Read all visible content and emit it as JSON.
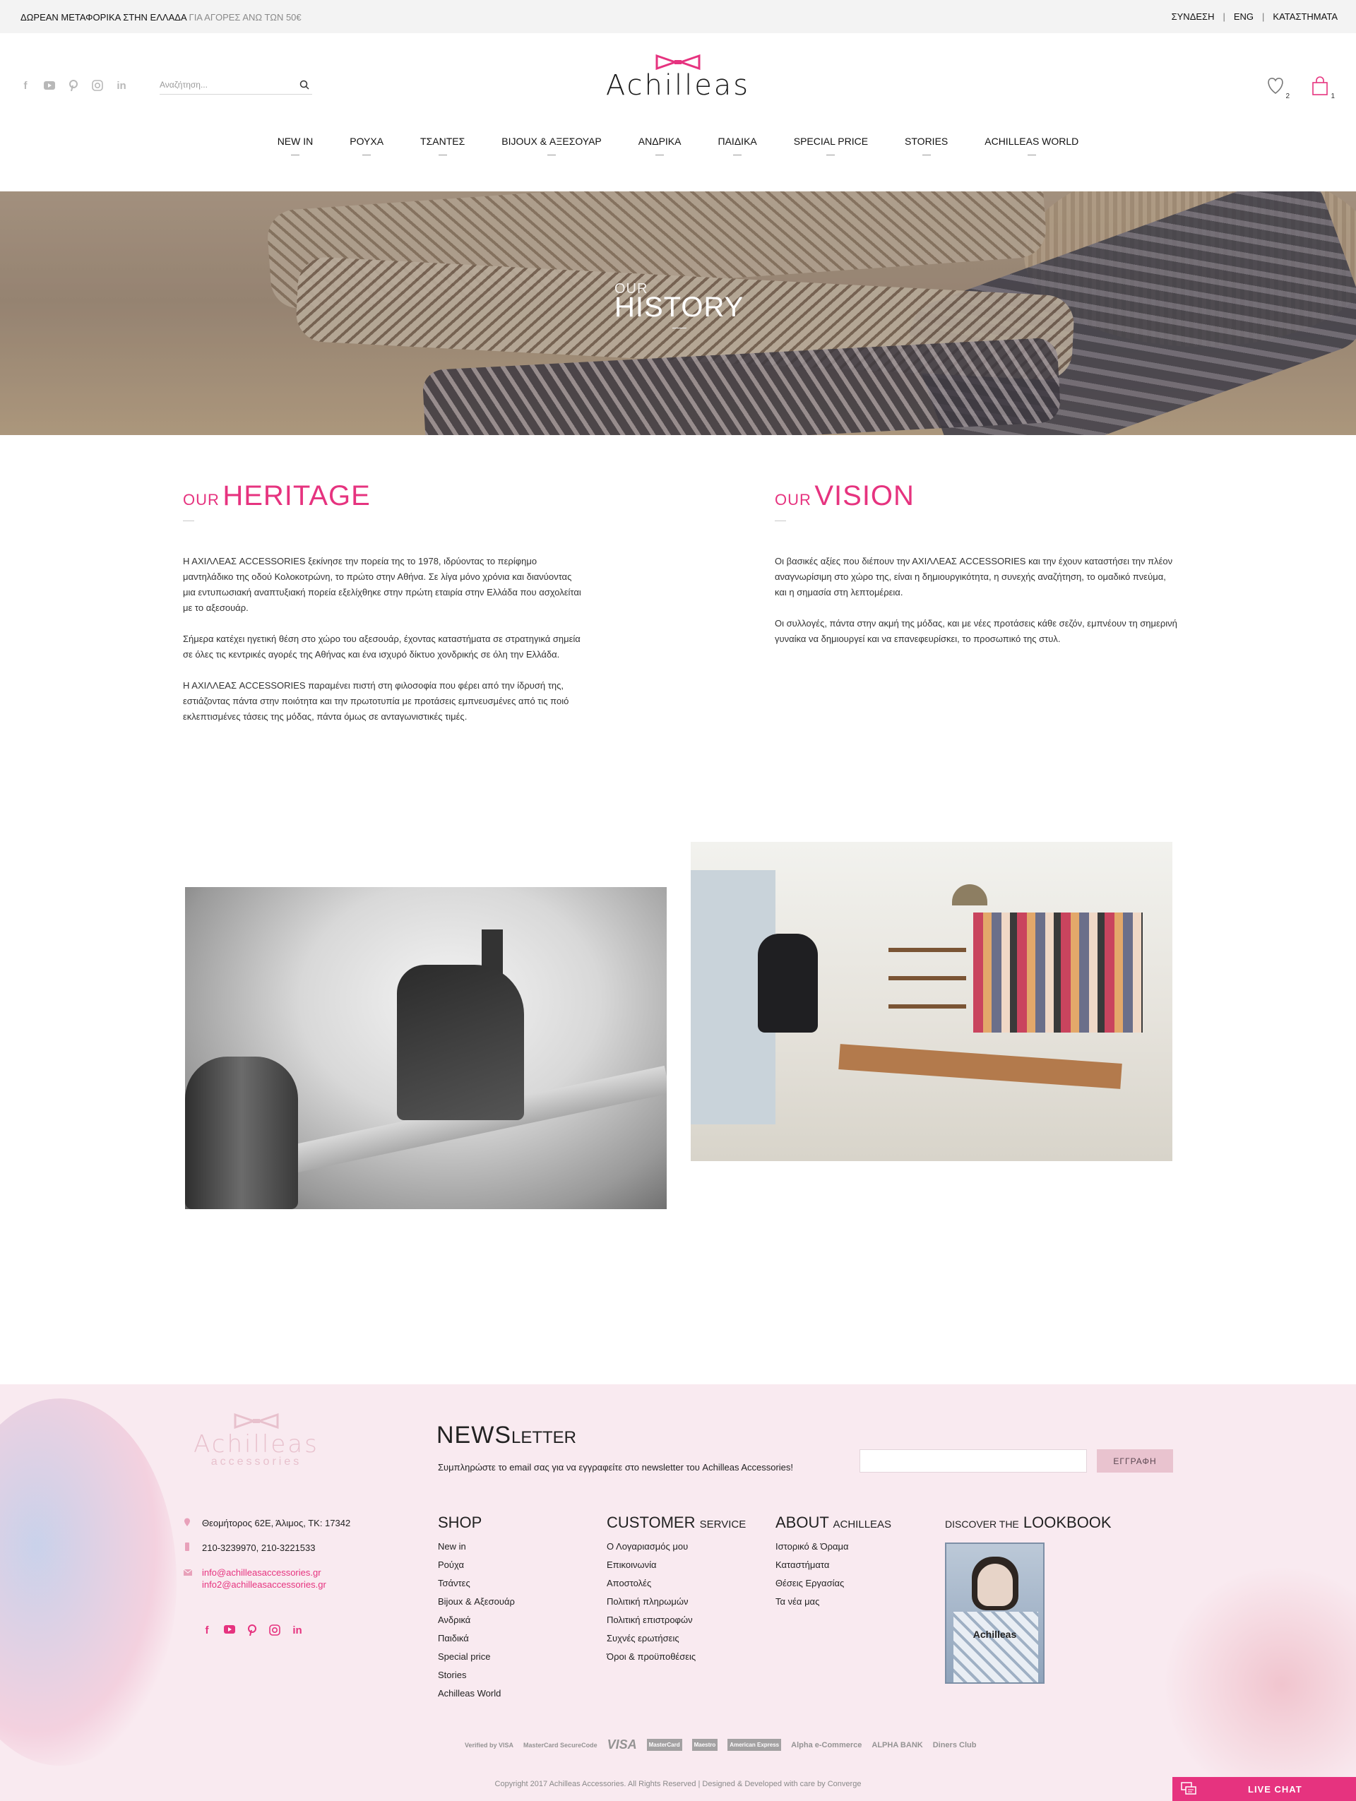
{
  "topbar": {
    "promo_strong": "ΔΩΡΕΑΝ ΜΕΤΑΦΟΡΙΚΑ ΣΤΗΝ ΕΛΛΑΔΑ",
    "promo_muted": "ΓΙΑ ΑΓΟΡΕΣ ΑΝΩ ΤΩΝ 50€",
    "login": "ΣΥΝΔΕΣΗ",
    "language": "ENG",
    "stores": "ΚΑΤΑΣΤΗΜΑΤΑ"
  },
  "header": {
    "search_placeholder": "Αναζήτηση...",
    "logo": "Achilleas",
    "wishlist_count": "2",
    "cart_count": "1",
    "social_icons": [
      "facebook-icon",
      "youtube-icon",
      "pinterest-icon",
      "instagram-icon",
      "linkedin-icon"
    ]
  },
  "nav": [
    "NEW IN",
    "ΡΟΥΧΑ",
    "ΤΣΑΝΤΕΣ",
    "BIJOUX & ΑΞΕΣΟΥΑΡ",
    "ΑΝΔΡΙΚΑ",
    "ΠΑΙΔΙΚΑ",
    "SPECIAL PRICE",
    "STORIES",
    "ACHILLEAS WORLD"
  ],
  "hero": {
    "small": "OUR",
    "big": "HISTORY"
  },
  "heritage": {
    "title_small": "OUR",
    "title_big": "HERITAGE",
    "p1": "Η ΑΧΙΛΛΕΑΣ ACCESSORIES ξεκίνησε την πορεία της το 1978, ιδρύοντας το περίφημο μαντηλάδικο της οδού Κολοκοτρώνη, το πρώτο στην Αθήνα. Σε λίγα μόνο χρόνια και διανύοντας μια εντυπωσιακή αναπτυξιακή πορεία εξελίχθηκε στην πρώτη εταιρία στην Ελλάδα που ασχολείται με το αξεσουάρ.",
    "p2": "Σήμερα κατέχει ηγετική θέση στο χώρο του αξεσουάρ, έχοντας καταστήματα σε στρατηγικά σημεία σε όλες τις κεντρικές αγορές της Αθήνας και ένα ισχυρό δίκτυο χονδρικής σε όλη την Ελλάδα.",
    "p3": "Η ΑΧΙΛΛΕΑΣ ACCESSORIES παραμένει πιστή στη φιλοσοφία που φέρει από την ίδρυσή της, εστιάζοντας πάντα στην ποιότητα και την πρωτοτυπία με προτάσεις εμπνευσμένες από τις ποιό εκλεπτισμένες τάσεις της μόδας, πάντα όμως σε ανταγωνιστικές τιμές."
  },
  "vision": {
    "title_small": "OUR",
    "title_big": "VISION",
    "p1": "Οι βασικές αξίες που διέπουν την ΑΧΙΛΛΕΑΣ ACCESSORIES και την έχουν καταστήσει την πλέον αναγνωρίσιμη στο χώρο της, είναι η δημιουργικότητα, η συνεχής αναζήτηση, το ομαδικό πνεύμα, και η σημασία στη λεπτομέρεια.",
    "p2": "Οι συλλογές, πάντα στην ακμή της μόδας, και με νέες προτάσεις κάθε σεζόν, εμπνέουν τη σημερινή γυναίκα να δημιουργεί και να επανεφευρίσκει, το προσωπικό της στυλ."
  },
  "footer": {
    "logo_name": "Achilleas",
    "logo_sub": "accessories",
    "newsletter_big": "NEWS",
    "newsletter_small": "LETTER",
    "newsletter_sub": "Συμπληρώστε το email σας για να εγγραφείτε στο newsletter του Achilleas Accessories!",
    "subscribe_label": "ΕΓΓΡΑΦΗ",
    "address": "Θεομήτορος 62Ε, Άλιμος, ΤΚ: 17342",
    "phone": "210-3239970, 210-3221533",
    "email1": "info@achilleasaccessories.gr",
    "email2": "info2@achilleasaccessories.gr",
    "shop_title": "SHOP",
    "shop_links": [
      "New in",
      "Ρούχα",
      "Τσάντες",
      "Bijoux & Αξεσουάρ",
      "Ανδρικά",
      "Παιδικά",
      "Special price",
      "Stories",
      "Achilleas World"
    ],
    "cs_title_big": "CUSTOMER",
    "cs_title_small": "SERVICE",
    "cs_links": [
      "Ο Λογαριασμός μου",
      "Επικοινωνία",
      "Αποστολές",
      "Πολιτική πληρωμών",
      "Πολιτική επιστροφών",
      "Συχνές ερωτήσεις",
      "Όροι & προϋποθέσεις"
    ],
    "about_title_big": "ABOUT",
    "about_title_small": "ACHILLEAS",
    "about_links": [
      "Ιστορικό & Όραμα",
      "Καταστήματα",
      "Θέσεις Εργασίας",
      "Τα νέα μας"
    ],
    "lookbook_small": "DISCOVER THE",
    "lookbook_big": "LOOKBOOK",
    "lookbook_cover_title": "Achilleas",
    "payment_methods": [
      "Verified by VISA",
      "MasterCard SecureCode",
      "VISA",
      "MasterCard",
      "Maestro",
      "American Express",
      "Alpha e-Commerce",
      "ALPHA BANK",
      "Diners Club"
    ],
    "copyright": "Copyright 2017 Achilleas Accessories. All Rights Reserved  |  Designed & Developed with care by Converge"
  },
  "livechat": {
    "label": "LIVE CHAT"
  },
  "colors": {
    "accent": "#e6337f",
    "footer_bg": "#f9eaf0",
    "topbar_bg": "#f3f3f3"
  }
}
